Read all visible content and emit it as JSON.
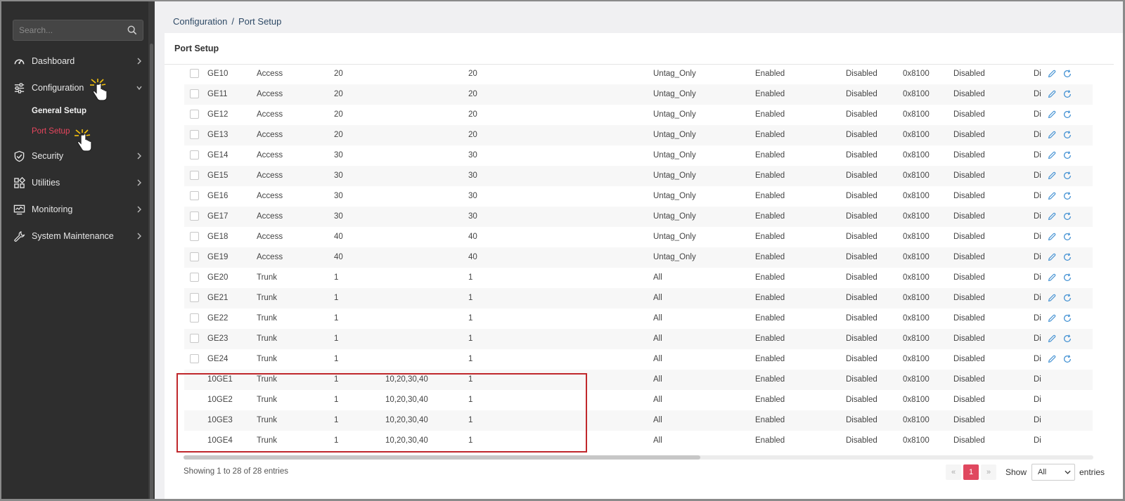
{
  "sidebar": {
    "search_placeholder": "Search...",
    "items": [
      {
        "label": "Dashboard",
        "icon": "dashboard-icon"
      },
      {
        "label": "Configuration",
        "icon": "sliders-icon"
      },
      {
        "label": "Security",
        "icon": "shield-check-icon"
      },
      {
        "label": "Utilities",
        "icon": "grid-icon"
      },
      {
        "label": "Monitoring",
        "icon": "monitor-chart-icon"
      },
      {
        "label": "System Maintenance",
        "icon": "wrench-icon"
      }
    ],
    "sub_items": [
      {
        "label": "General Setup"
      },
      {
        "label": "Port Setup",
        "active": true
      }
    ]
  },
  "breadcrumb": {
    "parent": "Configuration",
    "separator": "/",
    "current": "Port Setup"
  },
  "panel": {
    "title": "Port Setup"
  },
  "table": {
    "rows": [
      {
        "port": "GE10",
        "mode": "Access",
        "pvid": "20",
        "tagged": "",
        "untagged": "20",
        "accept": "Untag_Only",
        "ingress": "Enabled",
        "c8": "Disabled",
        "tpid": "0x8100",
        "c10": "Disabled",
        "c11": "Di",
        "selectable": true
      },
      {
        "port": "GE11",
        "mode": "Access",
        "pvid": "20",
        "tagged": "",
        "untagged": "20",
        "accept": "Untag_Only",
        "ingress": "Enabled",
        "c8": "Disabled",
        "tpid": "0x8100",
        "c10": "Disabled",
        "c11": "Di",
        "selectable": true
      },
      {
        "port": "GE12",
        "mode": "Access",
        "pvid": "20",
        "tagged": "",
        "untagged": "20",
        "accept": "Untag_Only",
        "ingress": "Enabled",
        "c8": "Disabled",
        "tpid": "0x8100",
        "c10": "Disabled",
        "c11": "Di",
        "selectable": true
      },
      {
        "port": "GE13",
        "mode": "Access",
        "pvid": "20",
        "tagged": "",
        "untagged": "20",
        "accept": "Untag_Only",
        "ingress": "Enabled",
        "c8": "Disabled",
        "tpid": "0x8100",
        "c10": "Disabled",
        "c11": "Di",
        "selectable": true
      },
      {
        "port": "GE14",
        "mode": "Access",
        "pvid": "30",
        "tagged": "",
        "untagged": "30",
        "accept": "Untag_Only",
        "ingress": "Enabled",
        "c8": "Disabled",
        "tpid": "0x8100",
        "c10": "Disabled",
        "c11": "Di",
        "selectable": true
      },
      {
        "port": "GE15",
        "mode": "Access",
        "pvid": "30",
        "tagged": "",
        "untagged": "30",
        "accept": "Untag_Only",
        "ingress": "Enabled",
        "c8": "Disabled",
        "tpid": "0x8100",
        "c10": "Disabled",
        "c11": "Di",
        "selectable": true
      },
      {
        "port": "GE16",
        "mode": "Access",
        "pvid": "30",
        "tagged": "",
        "untagged": "30",
        "accept": "Untag_Only",
        "ingress": "Enabled",
        "c8": "Disabled",
        "tpid": "0x8100",
        "c10": "Disabled",
        "c11": "Di",
        "selectable": true
      },
      {
        "port": "GE17",
        "mode": "Access",
        "pvid": "30",
        "tagged": "",
        "untagged": "30",
        "accept": "Untag_Only",
        "ingress": "Enabled",
        "c8": "Disabled",
        "tpid": "0x8100",
        "c10": "Disabled",
        "c11": "Di",
        "selectable": true
      },
      {
        "port": "GE18",
        "mode": "Access",
        "pvid": "40",
        "tagged": "",
        "untagged": "40",
        "accept": "Untag_Only",
        "ingress": "Enabled",
        "c8": "Disabled",
        "tpid": "0x8100",
        "c10": "Disabled",
        "c11": "Di",
        "selectable": true
      },
      {
        "port": "GE19",
        "mode": "Access",
        "pvid": "40",
        "tagged": "",
        "untagged": "40",
        "accept": "Untag_Only",
        "ingress": "Enabled",
        "c8": "Disabled",
        "tpid": "0x8100",
        "c10": "Disabled",
        "c11": "Di",
        "selectable": true
      },
      {
        "port": "GE20",
        "mode": "Trunk",
        "pvid": "1",
        "tagged": "",
        "untagged": "1",
        "accept": "All",
        "ingress": "Enabled",
        "c8": "Disabled",
        "tpid": "0x8100",
        "c10": "Disabled",
        "c11": "Di",
        "selectable": true
      },
      {
        "port": "GE21",
        "mode": "Trunk",
        "pvid": "1",
        "tagged": "",
        "untagged": "1",
        "accept": "All",
        "ingress": "Enabled",
        "c8": "Disabled",
        "tpid": "0x8100",
        "c10": "Disabled",
        "c11": "Di",
        "selectable": true
      },
      {
        "port": "GE22",
        "mode": "Trunk",
        "pvid": "1",
        "tagged": "",
        "untagged": "1",
        "accept": "All",
        "ingress": "Enabled",
        "c8": "Disabled",
        "tpid": "0x8100",
        "c10": "Disabled",
        "c11": "Di",
        "selectable": true
      },
      {
        "port": "GE23",
        "mode": "Trunk",
        "pvid": "1",
        "tagged": "",
        "untagged": "1",
        "accept": "All",
        "ingress": "Enabled",
        "c8": "Disabled",
        "tpid": "0x8100",
        "c10": "Disabled",
        "c11": "Di",
        "selectable": true
      },
      {
        "port": "GE24",
        "mode": "Trunk",
        "pvid": "1",
        "tagged": "",
        "untagged": "1",
        "accept": "All",
        "ingress": "Enabled",
        "c8": "Disabled",
        "tpid": "0x8100",
        "c10": "Disabled",
        "c11": "Di",
        "selectable": true
      },
      {
        "port": "10GE1",
        "mode": "Trunk",
        "pvid": "1",
        "tagged": "10,20,30,40",
        "untagged": "1",
        "accept": "All",
        "ingress": "Enabled",
        "c8": "Disabled",
        "tpid": "0x8100",
        "c10": "Disabled",
        "c11": "Di",
        "selectable": false
      },
      {
        "port": "10GE2",
        "mode": "Trunk",
        "pvid": "1",
        "tagged": "10,20,30,40",
        "untagged": "1",
        "accept": "All",
        "ingress": "Enabled",
        "c8": "Disabled",
        "tpid": "0x8100",
        "c10": "Disabled",
        "c11": "Di",
        "selectable": false
      },
      {
        "port": "10GE3",
        "mode": "Trunk",
        "pvid": "1",
        "tagged": "10,20,30,40",
        "untagged": "1",
        "accept": "All",
        "ingress": "Enabled",
        "c8": "Disabled",
        "tpid": "0x8100",
        "c10": "Disabled",
        "c11": "Di",
        "selectable": false
      },
      {
        "port": "10GE4",
        "mode": "Trunk",
        "pvid": "1",
        "tagged": "10,20,30,40",
        "untagged": "1",
        "accept": "All",
        "ingress": "Enabled",
        "c8": "Disabled",
        "tpid": "0x8100",
        "c10": "Disabled",
        "c11": "Di",
        "selectable": false
      }
    ]
  },
  "footer": {
    "info": "Showing 1 to 28 of 28 entries",
    "pagination": {
      "prev": "«",
      "current": "1",
      "next": "»"
    },
    "show_label": "Show",
    "page_size": "All",
    "entries_label": "entries"
  },
  "colors": {
    "accent": "#e0485f",
    "sidebar_bg": "#2e2e2e",
    "highlight_border": "#c0282c",
    "icon_blue": "#3f8fd2"
  }
}
